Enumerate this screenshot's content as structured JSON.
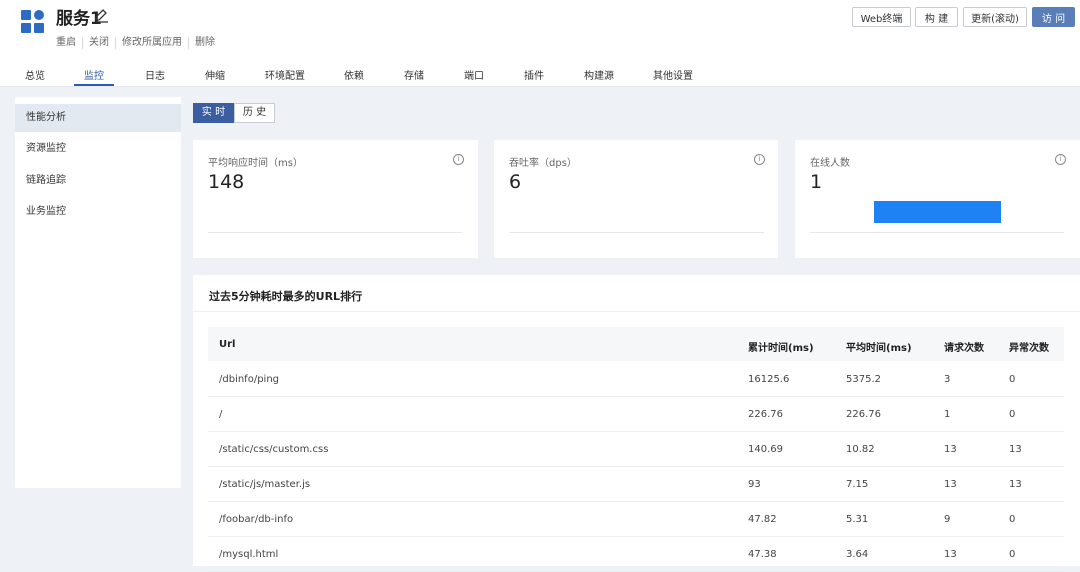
{
  "header": {
    "title": "服务1",
    "actions": [
      "重启",
      "关闭",
      "修改所属应用",
      "删除"
    ],
    "buttons": [
      "Web终端",
      "构 建",
      "更新(滚动)",
      "访 问"
    ]
  },
  "tabs": [
    "总览",
    "监控",
    "日志",
    "伸缩",
    "环境配置",
    "依赖",
    "存储",
    "端口",
    "插件",
    "构建源",
    "其他设置"
  ],
  "active_tab": "监控",
  "sidebar": {
    "items": [
      "性能分析",
      "资源监控",
      "链路追踪",
      "业务监控"
    ],
    "active": "性能分析"
  },
  "toggle": {
    "options": [
      "实 时",
      "历 史"
    ],
    "active": "实 时"
  },
  "cards": [
    {
      "label": "平均响应时间（ms）",
      "value": "148"
    },
    {
      "label": "吞吐率（dps）",
      "value": "6"
    },
    {
      "label": "在线人数",
      "value": "1"
    }
  ],
  "ranking": {
    "title": "过去5分钟耗时最多的URL排行",
    "columns": [
      "Url",
      "累计时间(ms)",
      "平均时间(ms)",
      "请求次数",
      "异常次数"
    ],
    "rows": [
      [
        "/dbinfo/ping",
        "16125.6",
        "5375.2",
        "3",
        "0"
      ],
      [
        "/",
        "226.76",
        "226.76",
        "1",
        "0"
      ],
      [
        "/static/css/custom.css",
        "140.69",
        "10.82",
        "13",
        "13"
      ],
      [
        "/static/js/master.js",
        "93",
        "7.15",
        "13",
        "13"
      ],
      [
        "/foobar/db-info",
        "47.82",
        "5.31",
        "9",
        "0"
      ],
      [
        "/mysql.html",
        "47.38",
        "3.64",
        "13",
        "0"
      ]
    ]
  },
  "colors": {
    "accent": "#2d5ea8",
    "primary_button": "#5a7fb8",
    "bar": "#1e82f5"
  }
}
